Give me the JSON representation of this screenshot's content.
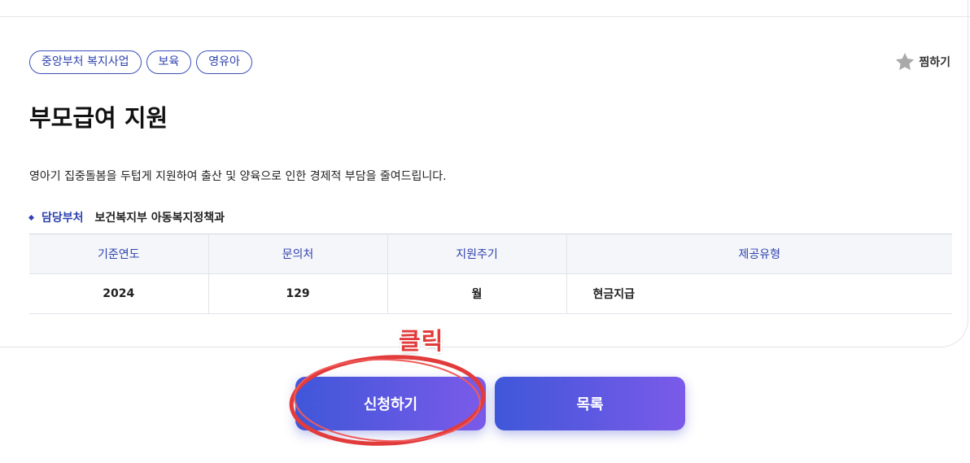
{
  "tags": [
    "중앙부처 복지사업",
    "보육",
    "영유아"
  ],
  "favorite": {
    "label": "찜하기",
    "icon": "star-icon"
  },
  "title": "부모급여 지원",
  "description": "영아기 집중돌봄을 두텁게 지원하여 출산 및 양육으로 인한 경제적 부담을 줄여드립니다.",
  "department": {
    "label": "담당부처",
    "value": "보건복지부 아동복지정책과"
  },
  "info_table": {
    "headers": [
      "기준연도",
      "문의처",
      "지원주기",
      "제공유형"
    ],
    "row": [
      "2024",
      "129",
      "월",
      "현금지급"
    ]
  },
  "annotation": {
    "text": "클릭",
    "color": "#e23b3b"
  },
  "buttons": {
    "apply": "신청하기",
    "list": "목록"
  },
  "colors": {
    "accent": "#2f43ad",
    "button_start": "#3f57d9",
    "button_end": "#7b5ae9"
  }
}
